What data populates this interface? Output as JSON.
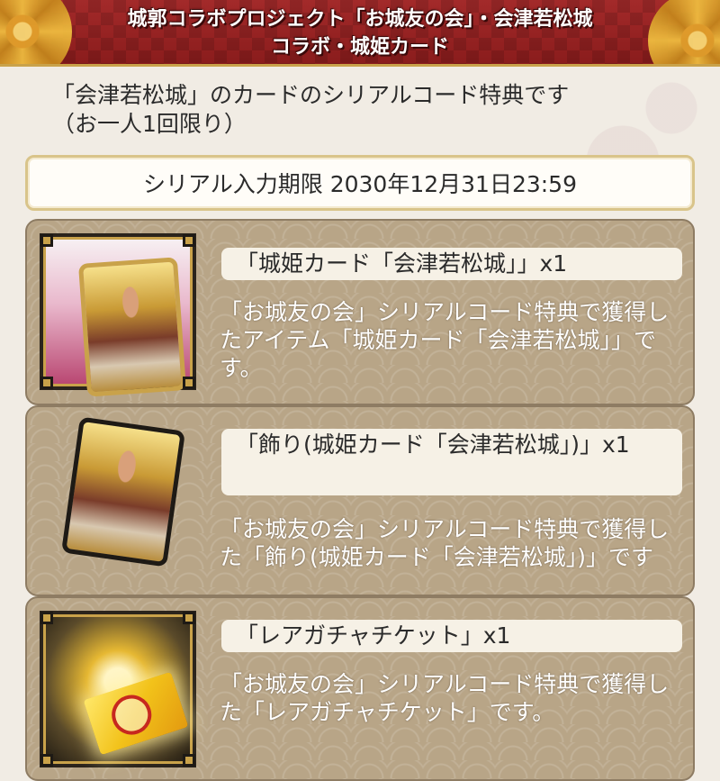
{
  "header": {
    "title_line1": "城郭コラボプロジェクト「お城友の会」・会津若松城",
    "title_line2": "コラボ・城姫カード"
  },
  "intro": {
    "line1": "「会津若松城」のカードのシリアルコード特典です",
    "line2": "（お一人1回限り）"
  },
  "deadline": {
    "text": "シリアル入力期限 2030年12月31日23:59"
  },
  "rewards": [
    {
      "title": "「城姫カード「会津若松城」」x1",
      "description": "「お城友の会」シリアルコード特典で獲得したアイテム「城姫カード「会津若松城」」です。",
      "icon": "castle-princess-card-icon"
    },
    {
      "title": "「飾り(城姫カード「会津若松城」)」x1",
      "description": "「お城友の会」シリアルコード特典で獲得した「飾り(城姫カード「会津若松城」)」です",
      "icon": "decoration-card-icon"
    },
    {
      "title": "「レアガチャチケット」x1",
      "description": "「お城友の会」シリアルコード特典で獲得した「レアガチャチケット」です。",
      "icon": "rare-gacha-ticket-icon"
    }
  ],
  "colors": {
    "header_red": "#8a1c1c",
    "gold_accent": "#c9a24a",
    "card_panel": "#b8a587",
    "background": "#f1ece4"
  }
}
